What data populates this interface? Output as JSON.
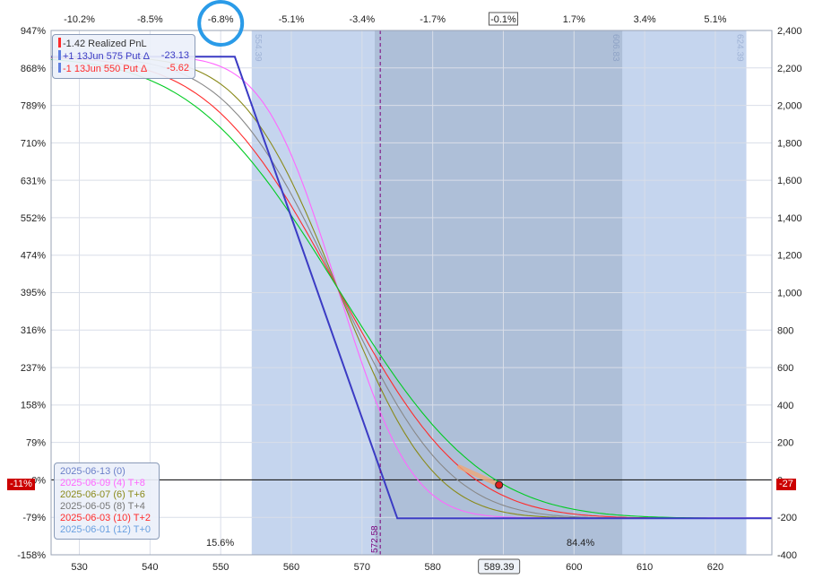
{
  "chart_data": {
    "type": "line",
    "x_range": [
      526,
      628
    ],
    "left_y_range": [
      -158,
      947
    ],
    "right_y_range": [
      -400,
      2400
    ],
    "top_axis_ticks": [
      {
        "label": "-10.2%",
        "x": 530
      },
      {
        "label": "-8.5%",
        "x": 540
      },
      {
        "label": "-6.8%",
        "x": 550
      },
      {
        "label": "-5.1%",
        "x": 560
      },
      {
        "label": "-3.4%",
        "x": 570
      },
      {
        "label": "-1.7%",
        "x": 580
      },
      {
        "label": "-0.1%",
        "x": 590
      },
      {
        "label": "1.7%",
        "x": 600
      },
      {
        "label": "3.4%",
        "x": 610
      },
      {
        "label": "5.1%",
        "x": 620
      }
    ],
    "top_axis_current_label": "-0.1%",
    "top_axis_circled_label": "-6.8%",
    "bottom_axis_ticks": [
      530,
      540,
      550,
      560,
      570,
      580,
      590,
      600,
      610,
      620
    ],
    "bottom_axis_ticks_text": [
      "530",
      "540",
      "550",
      "560",
      "570",
      "580",
      "590",
      "600",
      "610",
      "620"
    ],
    "current_price_label": "589.39",
    "current_price": 589.39,
    "left_axis_ticks": [
      947,
      868,
      789,
      710,
      631,
      552,
      474,
      395,
      316,
      237,
      158,
      79,
      0,
      -79,
      -158
    ],
    "left_axis_ticks_text": [
      "947%",
      "868%",
      "789%",
      "710%",
      "631%",
      "552%",
      "474%",
      "395%",
      "316%",
      "237%",
      "158%",
      "79%",
      "0%",
      "-79%",
      "-158%"
    ],
    "right_axis_ticks": [
      2400,
      2200,
      2000,
      1800,
      1600,
      1400,
      1200,
      1000,
      800,
      600,
      400,
      200,
      0,
      -200,
      -400
    ],
    "right_axis_ticks_text": [
      "2,400",
      "2,200",
      "2,000",
      "1,800",
      "1,600",
      "1,400",
      "1,200",
      "1,000",
      "800",
      "600",
      "400",
      "200",
      "0",
      "-200",
      "-400"
    ],
    "left_current_tag": "-11%",
    "right_current_tag": "-27",
    "bands": [
      {
        "from": 554.39,
        "to": 624.39,
        "color": "#c5d5ee",
        "label_left": "554.39",
        "label_right": "624.39"
      },
      {
        "from": 571.8,
        "to": 606.83,
        "color": "#aebfd8",
        "label_right": "606.83"
      }
    ],
    "band_label_554": "554.39",
    "band_label_606": "606.83",
    "band_label_624": "624.39",
    "breakeven": {
      "x": 572.58,
      "label": "572.58",
      "color": "#7a007a"
    },
    "probability_left": "15.6%",
    "probability_right": "84.4%",
    "current_point": {
      "x": 589.39,
      "y": -27
    },
    "series": [
      {
        "label": "2025-06-13 (0)",
        "color": "#3b3bc4",
        "type": "expiry",
        "points": [
          [
            526,
            2260
          ],
          [
            552,
            2260
          ],
          [
            575,
            -205
          ],
          [
            628,
            -205
          ]
        ]
      },
      {
        "label": "2025-06-09 (4) T+8",
        "color": "#ff66ff",
        "sigma": 8.2,
        "offset": 2
      },
      {
        "label": "2025-06-07 (6) T+6",
        "color": "#8a8a1a",
        "sigma": 10.6,
        "offset": 1
      },
      {
        "label": "2025-06-05 (8) T+4",
        "color": "#888888",
        "sigma": 12.3,
        "offset": 0
      },
      {
        "label": "2025-06-03 (10) T+2",
        "color": "#ff2b2b",
        "sigma": 14.2,
        "offset": 0
      },
      {
        "label": "2025-06-01 (12) T+0",
        "color": "#00cc22",
        "sigma": 16.2,
        "offset": 0
      }
    ],
    "legend_top": [
      {
        "label": "-1.42 Realized PnL",
        "color": "#333333",
        "swatch": "#ff2b2b",
        "value": ""
      },
      {
        "label": "+1 13Jun 575 Put Δ",
        "color": "#3b3bc4",
        "swatch": "#5f7fe0",
        "value": "-23.13"
      },
      {
        "label": "-1 13Jun 550 Put Δ",
        "color": "#ff2b2b",
        "swatch": "#5f7fe0",
        "value": "-5.62"
      }
    ],
    "legend_bottom": [
      {
        "label": "2025-06-13 (0)",
        "color": "#6a7fc8"
      },
      {
        "label": "2025-06-09 (4) T+8",
        "color": "#ff66ff"
      },
      {
        "label": "2025-06-07 (6) T+6",
        "color": "#8a8a1a"
      },
      {
        "label": "2025-06-05 (8) T+4",
        "color": "#777777"
      },
      {
        "label": "2025-06-03 (10) T+2",
        "color": "#ff2b2b"
      },
      {
        "label": "2025-06-01 (12) T+0",
        "color": "#6aa0e0"
      }
    ]
  }
}
